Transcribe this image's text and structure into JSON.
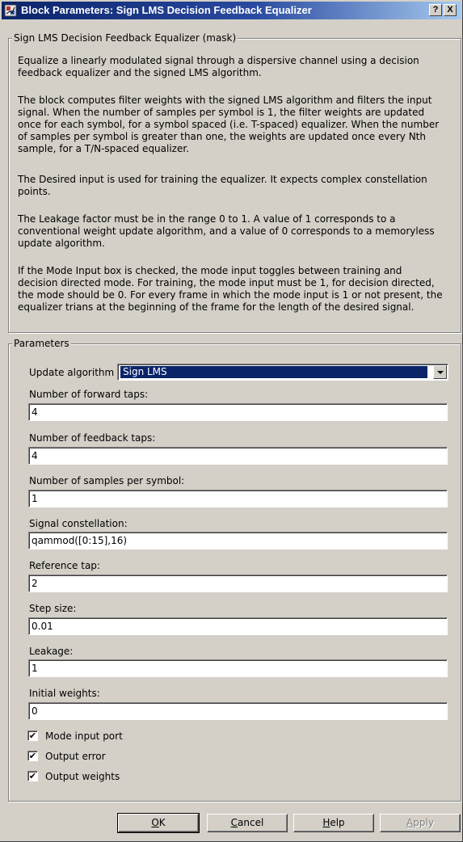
{
  "window": {
    "title": "Block Parameters: Sign LMS Decision Feedback Equalizer",
    "help_button": "?",
    "close_button": "X"
  },
  "description_group": {
    "label": "Sign LMS Decision Feedback Equalizer (mask)",
    "paragraphs": [
      [
        "Equalize a linearly modulated signal through a dispersive channel using a decision",
        "feedback equalizer and the signed LMS algorithm."
      ],
      [
        "The block computes filter weights with the signed LMS algorithm and filters the input",
        "signal. When the number of samples per symbol is 1, the filter weights are updated",
        "once for each symbol, for a symbol spaced (i.e. T-spaced) equalizer. When the number",
        "of samples per symbol is greater than one, the weights are updated once every Nth",
        "sample, for a T/N-spaced equalizer."
      ],
      [
        "The Desired input is used for training the equalizer. It expects complex constellation",
        "points."
      ],
      [
        "The Leakage factor must be in the range 0 to 1.  A value of 1 corresponds to a",
        "conventional weight update algorithm, and a value of 0 corresponds to a memoryless",
        "update algorithm."
      ],
      [
        "If the Mode Input box is checked, the mode input toggles between training and",
        "decision directed mode. For training, the mode input must be 1, for decision directed,",
        "the mode should be 0. For every frame in which the mode input is 1 or not present, the",
        "equalizer trians at the beginning of the frame for the length of the desired signal."
      ]
    ]
  },
  "parameters_group": {
    "label": "Parameters",
    "update_algorithm": {
      "label": "Update algorithm",
      "value": "Sign LMS"
    },
    "fields": [
      {
        "label": "Number of forward taps:",
        "value": "4"
      },
      {
        "label": "Number of feedback taps:",
        "value": "4"
      },
      {
        "label": "Number of samples per symbol:",
        "value": "1"
      },
      {
        "label": "Signal constellation:",
        "value": "qammod([0:15],16)"
      },
      {
        "label": "Reference tap:",
        "value": "2"
      },
      {
        "label": "Step size:",
        "value": "0.01"
      },
      {
        "label": "Leakage:",
        "value": "1"
      },
      {
        "label": "Initial weights:",
        "value": "0"
      }
    ],
    "checkboxes": [
      {
        "label": "Mode input port",
        "checked": true,
        "mark": "✔"
      },
      {
        "label": "Output error",
        "checked": true,
        "mark": "✔"
      },
      {
        "label": "Output weights",
        "checked": true,
        "mark": "✔"
      }
    ]
  },
  "buttons": {
    "ok": {
      "mnemonic": "O",
      "rest": "K"
    },
    "cancel": {
      "mnemonic": "C",
      "rest": "ancel"
    },
    "help": {
      "mnemonic": "H",
      "rest": "elp"
    },
    "apply": {
      "mnemonic": "A",
      "rest": "pply"
    }
  }
}
